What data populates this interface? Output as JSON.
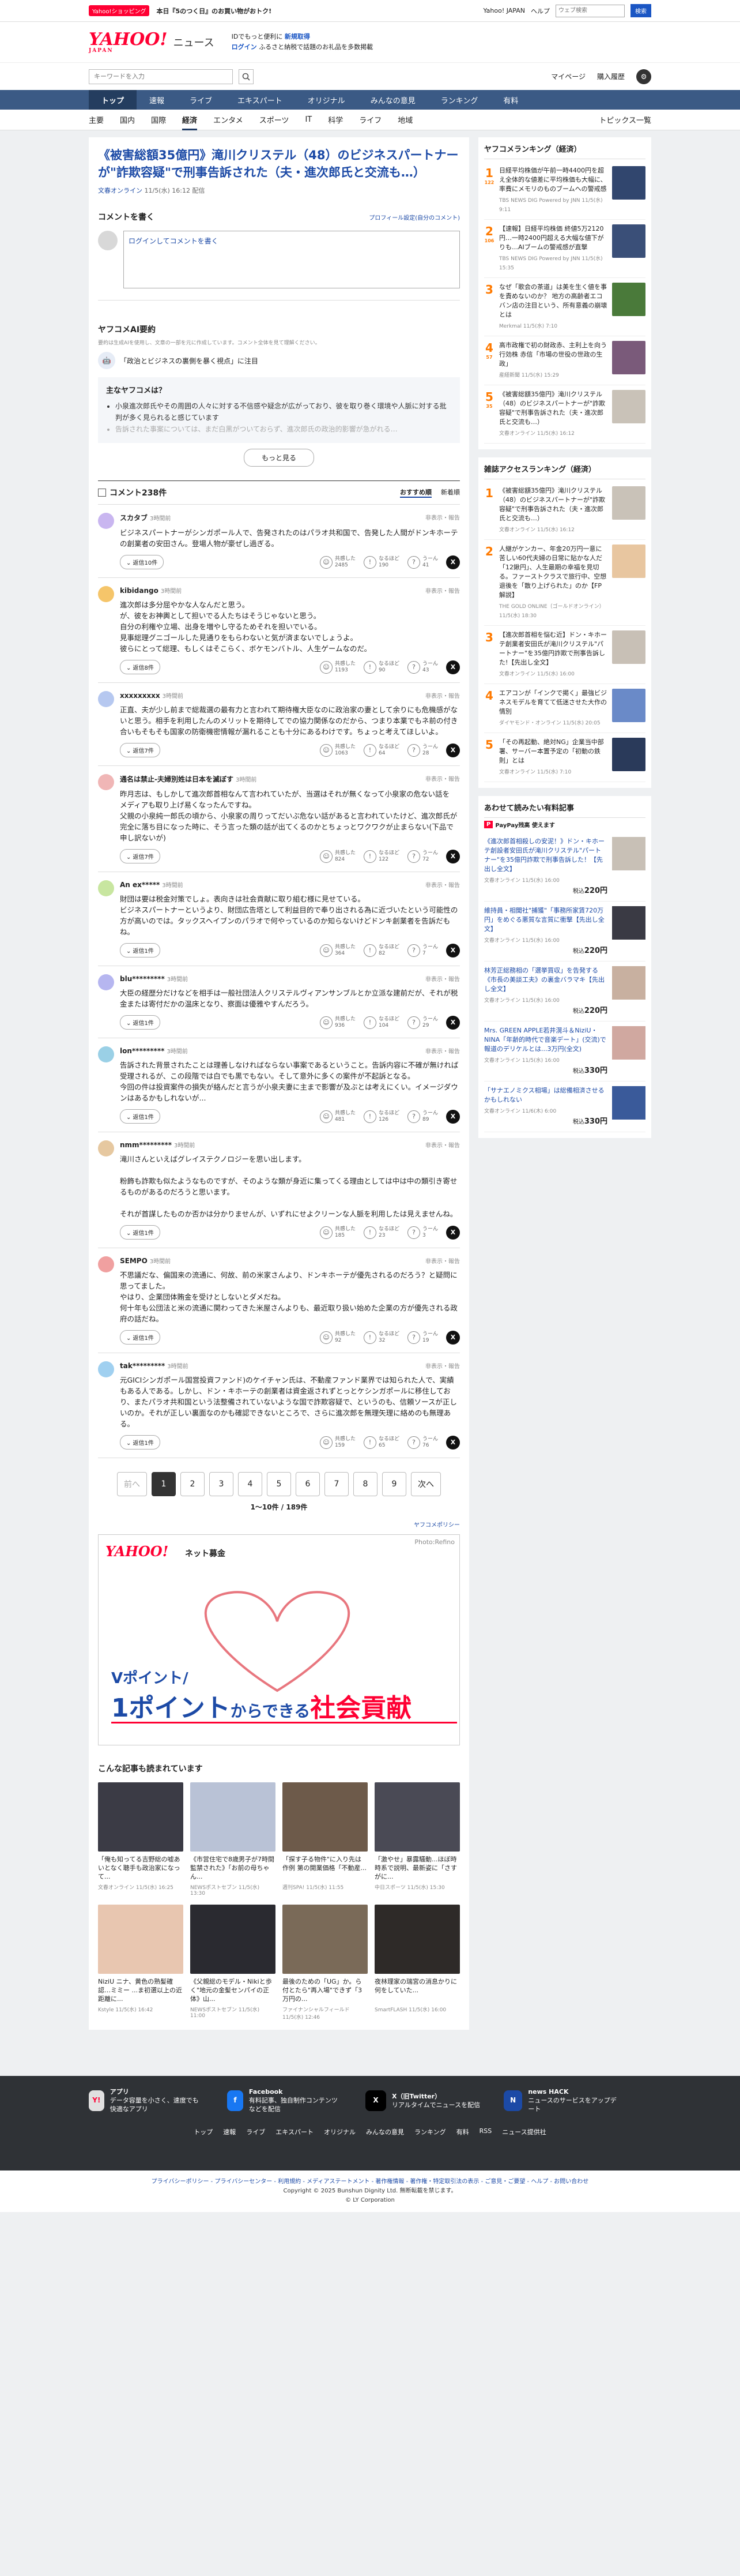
{
  "topbar": {
    "badge": "Yahoo!ショッピング",
    "promo": "本日『5のつく日』のお買い物がおトク!",
    "links": [
      "Yahoo! JAPAN",
      "ヘルプ"
    ],
    "search_placeholder": "ウェブ検索",
    "search_label": "検索"
  },
  "header": {
    "logo": "YAHOO!",
    "logo_sub": "JAPAN",
    "section": "ニュース",
    "msg1_prefix": "IDでもっと便利に",
    "msg1_link": "新規取得",
    "msg2_prefix": "ログイン",
    "msg2_text": "ふるさと納税で話題のお礼品を多数掲載"
  },
  "subhead": {
    "search_placeholder": "キーワードを入力",
    "mypage": "マイページ",
    "notice": "購入履歴"
  },
  "gnav": [
    "トップ",
    "速報",
    "ライブ",
    "エキスパート",
    "オリジナル",
    "みんなの意見",
    "ランキング",
    "有料"
  ],
  "subnav": {
    "items": [
      "主要",
      "国内",
      "国際",
      "経済",
      "エンタメ",
      "スポーツ",
      "IT",
      "科学",
      "ライフ",
      "地域"
    ],
    "right": "トピックス一覧"
  },
  "article": {
    "title": "《被害総額35億円》滝川クリステル（48）のビジネスパートナーが\"詐欺容疑\"で刑事告訴された（夫・進次郎氏と交流も…）",
    "source": "文春オンライン",
    "date": "11/5(水) 16:12 配信"
  },
  "comment_box": {
    "heading": "コメントを書く",
    "profile_link": "プロフィール設定(自分のコメント)",
    "placeholder": "ログインしてコメントを書く"
  },
  "ai": {
    "title": "ヤフコメAI要約",
    "note": "要約は生成AIを使用し、文章の一部を元に作成しています。コメント全体を見て理解ください。",
    "question": "「政治とビジネスの裏側を暴く視点」に注目",
    "box_title": "主なヤフコメは？",
    "items": [
      "小泉進次郎氏やその周囲の人々に対する不信感や疑念が広がっており、彼を取り巻く環境や人脈に対する批判が多く見られると感じています",
      "告訴された事案については、まだ白黒がついておらず、進次郎氏の政治的影響が急がれる…"
    ],
    "more": "もっと見る"
  },
  "comments_header": {
    "title": "コメント238件",
    "sort_label": "おすすめ順",
    "sort_new": "新着順"
  },
  "comments": [
    {
      "user": "スカタブ",
      "time": "3時間前",
      "text": "ビジネスパートナーがシンガポール人で、告発されたのはパラオ共和国で、告発した人間がドンキホーテの創業者の安田さん。登場人物が豪ぜし過ぎる。",
      "reply": "返信10件",
      "v1": "2485",
      "v2": "190",
      "v3": "41",
      "color": "#c9b6f0"
    },
    {
      "user": "kibidango",
      "time": "3時間前",
      "text": "進次郎は多分屈やかな人なんだと思う。\nが、彼をお神輿として担いでる人たちはそうじゃないと思う。\n自分の利権や立場、出身を増やし守るためそれを担いでいる。\n見事総理グニゴールした見通りをもらわないと気が済まないでしょうよ。\n彼らにとって総理、もしくはそこらく、ボケモンバトル、人生ゲームなのだ。",
      "reply": "返信8件",
      "v1": "1193",
      "v2": "90",
      "v3": "43",
      "color": "#f5c56a"
    },
    {
      "user": "xxxxxxxxx",
      "time": "3時間前",
      "text": "正直、夫が少し前まで総裁選の最有力と言われて期待権大臣なのに政治家の妻として余りにも危機感がないと思う。相手を利用したんのメリットを期待してでの協力関係なのだから、つまり本業でもネ前の付き合いもそもそも国家の防衛機密情報が漏れることも十分にあるわけです。ちょっと考えてほしいよ。",
      "reply": "返信7件",
      "v1": "1063",
      "v2": "64",
      "v3": "28",
      "color": "#b6c8f0"
    },
    {
      "user": "通名は禁止-夫婦別姓は日本を滅ぼす",
      "time": "3時間前",
      "text": "昨月志は、もしかして進次郎首相なんて言われていたが、当選はそれが無くなって小泉家の危ない話を\nメディアも取り上げ易くなったんですね。\n父親の小泉純一郎氏の頃から、小泉家の周りってだいぶ危ない話があると言われていたけど、進次郎氏が完全に落ち目になった時に、そう言った類の話が出てくるのかとちょっとワクワクが止まらない(下品で申し訳ないが)",
      "reply": "返信7件",
      "v1": "824",
      "v2": "122",
      "v3": "72",
      "color": "#f0b6b6"
    },
    {
      "user": "An ex*****",
      "time": "3時間前",
      "text": "財団は要は税金対策でしょ。表向きは社会貢献に取り組む様に見せている。\nビジネスパートナーというより、財団広告塔として利益目的で奉り出される為に近づいたという可能性の方が高いのでは。タックスヘイブンのパラオで何やっているのか知らないけどドンキ創業者を告訴だもね。",
      "reply": "返信1件",
      "v1": "364",
      "v2": "82",
      "v3": "7",
      "color": "#c8e6a0"
    },
    {
      "user": "blu*********",
      "time": "3時間前",
      "text": "大臣の経歴分だけなどを相手は一般社団法人クリステルヴィアンサンブルとか立派な建前だが、それが税金または寄付だかの温床となり、察面は優雅やすんだろう。",
      "reply": "返信1件",
      "v1": "936",
      "v2": "104",
      "v3": "29",
      "color": "#b6b6f0"
    },
    {
      "user": "lon*********",
      "time": "3時間前",
      "text": "告訴された背景されたことは理善しなければならない事案であるということ。告訴内容に不確が無ければ受理されるが、この段階では白でも黒でもない。そして意外に多くの案件が不起訴となる。\n今回の件は投資案件の損失が絡んだと言うが小泉夫妻に主まで影響が及ぶとは考えにくい。イメージダウンはあるかもしれないが...",
      "reply": "返信1件",
      "v1": "481",
      "v2": "126",
      "v3": "89",
      "color": "#9ad0e6"
    },
    {
      "user": "nmm*********",
      "time": "3時間前",
      "text": "滝川さんといえばグレイステクノロジーを思い出します。\n\n粉飾も詐欺も似たようなものですが、そのような類が身近に集ってくる理由としては中は中の類引き寄せるものがあるのだろうと思います。\n\nそれが首謀したものか否かは分かりませんが、いずれにせよクリーンな人脈を利用したは見えませんね。",
      "reply": "返信1件",
      "v1": "185",
      "v2": "23",
      "v3": "3",
      "color": "#e6c8a0"
    },
    {
      "user": "SEMPO",
      "time": "3時間前",
      "text": "不思議だな、偏国来の流通に、何故、前の米家さんより、ドンキホーテが優先されるのだろう？と疑問に思ってました。\nやはり、企業団体賄金を受けとしないとダメだね。\n何十年も公団法と米の流通に関わってきた米屋さんよりも、最近取り扱い始めた企業の方が優先される政府の話だね。",
      "reply": "返信1件",
      "v1": "92",
      "v2": "32",
      "v3": "19",
      "color": "#f0a0a0"
    },
    {
      "user": "tak*********",
      "time": "3時間前",
      "text": "元GICIシンガポール国営投資ファンド)のケイチャン氏は、不動産ファンド業界では知られた人で、実績もある人である。しかし、ドン・キホーテの創業者は資金返されずとっとケシンガポールに移住しており、またパラオ共和国という法整備されていないような国で詐欺容疑で、というのも、信頼ソースが正しいのか。それが正しい裏面なのかも確認できないところで、さらに進次郎を無理矢理に絡めのも無理ある。",
      "reply": "返信1件",
      "v1": "159",
      "v2": "65",
      "v3": "76",
      "color": "#a0d0f0"
    }
  ],
  "pager": {
    "prev": "前へ",
    "pages": [
      "1",
      "2",
      "3",
      "4",
      "5",
      "6",
      "7",
      "8",
      "9"
    ],
    "next": "次へ",
    "count": "1〜10件 / 189件"
  },
  "ad": {
    "policy": "ヤフコメポリシー",
    "brand": "YAHOO!",
    "fund": "ネット募金",
    "photo": "Photo:Refino",
    "copy1": "Vポイント/",
    "copy2_a": "1ポイント",
    "copy2_b": "からできる",
    "copy2_c": "社会貢献"
  },
  "related": {
    "title": "こんな記事も読まれています",
    "items": [
      {
        "t": "「俺も知ってる吉野総の嘘あいとなく聴手も政治家になって...",
        "s": "文春オンライン 11/5(水) 16:25",
        "c": "#3b3b45"
      },
      {
        "t": "《市営住宅で8歳男子が7時間監禁された》「お前の母ちゃん...",
        "s": "NEWSポストセブン 11/5(水) 13:30",
        "c": "#b9c2d6"
      },
      {
        "t": "「探す子る物件\"に入り先は 作例 第の開業価格「不動産...",
        "s": "週刊SPA! 11/5(水) 11:55",
        "c": "#6d5a4a"
      },
      {
        "t": "「激やせ」暴露騒動...ほぼ時時系で説明、最新姿に「さすがに...",
        "s": "中日スポーツ 11/5(水) 15:30",
        "c": "#4a4a55"
      },
      {
        "t": "NiziU ニナ、黄色の熟髪確認…ミミー ...ま初選以上の近距離に...",
        "s": "Kstyle 11/5(水) 16:42",
        "c": "#e8c6b0"
      },
      {
        "t": "《父親総のモデル・Nikiと歩く\"地元の金髪センパイの正体》山...",
        "s": "NEWSポストセブン 11/5(水) 11:00",
        "c": "#2a2a30"
      },
      {
        "t": "最後のための「UG」か。ら付とたら\"再入場\"できず「3万円の...",
        "s": "ファイナンシャルフィールド 11/5(水) 12:46",
        "c": "#7a6a58"
      },
      {
        "t": "夜林理家の瑞宮の消息かりに何をしていた...",
        "s": "SmartFLASH 11/5(水) 16:00",
        "c": "#2e2a28"
      }
    ]
  },
  "rank1": {
    "title": "ヤフコメランキング（経済）",
    "sub": "",
    "items": [
      {
        "n": "1",
        "c": "122",
        "t": "日経平均株価が午前一時4400円を超え全体的な値差に平均株価も大幅に、率費にメモリのものブームへの警戒感",
        "s": "TBS NEWS DIG Powered by JNN 11/5(水) 9:11",
        "color": "#31466e"
      },
      {
        "n": "2",
        "c": "106",
        "t": "【速報】日経平均株価 終値5万2120円…一時2400円超える大幅な値下がりも…AIブームの警戒感が直撃",
        "s": "TBS NEWS DIG Powered by JNN 11/5(水) 15:35",
        "color": "#3a4f78"
      },
      {
        "n": "3",
        "c": "",
        "t": "なぜ「歌会の茶道」は美を生く値を事を責めないのか？ 地方の高齢者エコバン店の注目という、所有意義の崩壊とは",
        "s": "Merkmal 11/5(水) 7:10",
        "color": "#4a7a3a"
      },
      {
        "n": "4",
        "c": "57",
        "t": "高市政権で初の財政赤、主利上を向う行効株 赤信「市場の世役の世政の生政」",
        "s": "産経新聞 11/5(水) 15:29",
        "color": "#7a5a7a"
      },
      {
        "n": "5",
        "c": "35",
        "t": "《被害総額35億円》滝川クリステル（48）のビジネスパートナーが\"詐欺容疑\"で刑事告訴された（夫・進次郎氏と交流も…）",
        "s": "文春オンライン 11/5(水) 16:12",
        "color": "#c9c2b8"
      }
    ]
  },
  "rank2": {
    "title": "雑誌アクセスランキング（経済）",
    "items": [
      {
        "n": "1",
        "t": "《被害総額35億円》滝川クリステル（48）のビジネスパートナーが\"詐欺容疑\"で刑事告訴された（夫・進次郎氏と交流も…）",
        "s": "文春オンライン 11/5(水) 16:12",
        "color": "#c9c2b8"
      },
      {
        "n": "2",
        "t": "人継がケンカー、年金20万円一意に苦しい60代夫婦の日常に貼かな人だ「12鍬円」、人生最期の幸福を見切る。ファーストクラスで旅行中、空想退後を「散り上げられた」のか【FP解説】",
        "s": "THE GOLD ONLINE（ゴールドオンライン）11/5(水) 18:30",
        "color": "#e8c6a0"
      },
      {
        "n": "3",
        "t": "【進次郎首相を悩む近】ドン・キホーテ創業者安田氏が滝川クリステル\"パートナー\"を35億円詐欺で刑事告訴した!【先出し全文】",
        "s": "文春オンライン 11/5(水) 16:00",
        "color": "#c8c0b6"
      },
      {
        "n": "4",
        "t": "エアコンが「インクで掲く」最強ビジネスモデルを育てて低迷させた大作の情別",
        "s": "ダイヤモンド・オンライン 11/5(水) 20:05",
        "color": "#6a8ac8"
      },
      {
        "n": "5",
        "t": "「その再起動、絶対NG」企業当中部署、サーバー本置予定の「初動の鉄則」とは",
        "s": "文春オンライン 11/5(水) 7:10",
        "color": "#2a3a5a"
      }
    ]
  },
  "shop": {
    "title": "あわせて読みたい有料記事",
    "pp": "PayPay残高 使えます",
    "items": [
      {
        "t": "《進次郎首相殺しの安泥！》ドン・キホーテ創設者安田氏が滝川クリステル\"パートナー\"を35億円詐欺で刑事告訴した！【先出し全文】",
        "s": "文春オンライン 11/5(水) 16:00",
        "p": "220",
        "color": "#c8c0b6"
      },
      {
        "t": "維持員・相聞社\"捕獲\"「事務所家賃720万円」をめぐる悪質な言質に衝撃【先出し全文】",
        "s": "文春オンライン 11/5(水) 16:00",
        "p": "220",
        "color": "#3a3a44"
      },
      {
        "t": "林芳正総務相の「選挙買収」を告発する《市長の美談工夫》の裏金バラマキ【先出し全文】",
        "s": "文春オンライン 11/5(水) 16:00",
        "p": "220",
        "color": "#c8b0a0"
      },
      {
        "t": "Mrs. GREEN APPLE若井滉斗＆NiziU・NINA「年齢的時代で音楽デート」(交流)で報道のデリケルとは...3万円(全文)",
        "s": "文春オンライン 11/5(水) 16:00",
        "p": "330",
        "color": "#d0a8a0"
      },
      {
        "t": "「サナエノミクス相場」は総備相済させるかもしれない",
        "s": "文春オンライン 11/6(木) 6:00",
        "p": "330",
        "color": "#3a5a9a"
      }
    ]
  },
  "footer": {
    "apps": [
      {
        "name": "アプリ",
        "desc": "データ容量を小さく、速度でも快適なアプリ",
        "icon": "Y!",
        "color": "#e0e0e0",
        "fg": "#ff0033"
      },
      {
        "name": "Facebook",
        "desc": "有料記事、独自制作コンテンツなどを配信",
        "icon": "f",
        "color": "#1877f2",
        "fg": "#fff"
      },
      {
        "name": "X（旧Twitter）",
        "desc": "リアルタイムでニュースを配信",
        "icon": "X",
        "color": "#000",
        "fg": "#fff"
      },
      {
        "name": "news HACK",
        "desc": "ニュースのサービスをアップデート",
        "icon": "N",
        "color": "#1c4aa6",
        "fg": "#fff"
      }
    ],
    "nav": [
      "トップ",
      "速報",
      "ライブ",
      "エキスパート",
      "オリジナル",
      "みんなの意見",
      "ランキング",
      "有料",
      "RSS",
      "ニュース提供社"
    ],
    "links": "プライバシーポリシー - プライバシーセンター - 利用規約 - メディアステートメント - 著作権情報 - 著作権・特定取引法の表示 - ご意見・ご要望 - ヘルプ - お問い合わせ",
    "copy1": "Copyright © 2025 Bunshun Dignity Ltd. 無断転載を禁じます。",
    "copy2": "© LY Corporation"
  }
}
